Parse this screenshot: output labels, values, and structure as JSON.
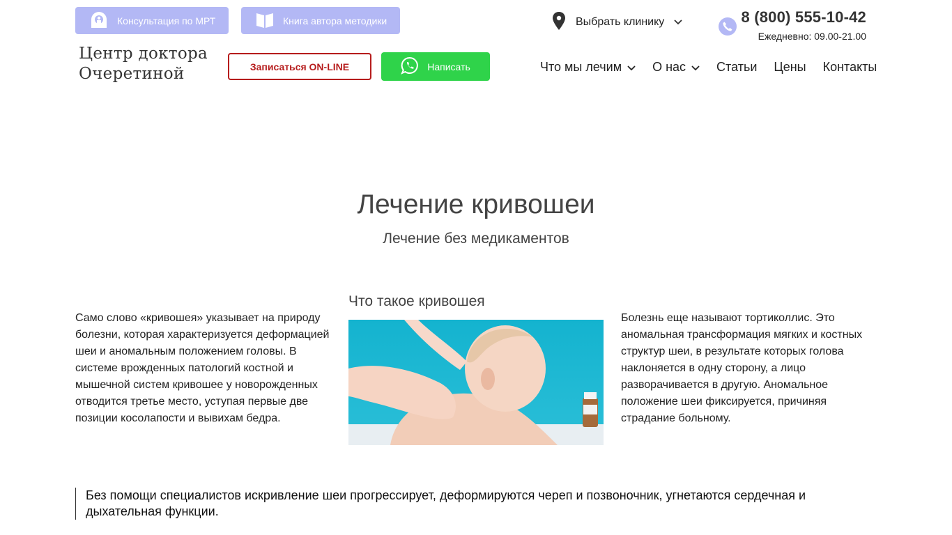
{
  "top_bar": {
    "mri_label": "Консультация по МРТ",
    "book_label": "Книга автора методики",
    "clinic_label": "Выбрать клинику",
    "phone": "8 (800) 555-10-42",
    "hours": "Ежедневно: 09.00-21.00"
  },
  "header": {
    "logo_line1": "Центр доктора",
    "logo_line2": "Очеретиной",
    "online_label": "Записаться ON-LINE",
    "whatsapp_label": "Написать"
  },
  "nav": {
    "items": [
      {
        "label": "Что мы лечим",
        "has_dropdown": true
      },
      {
        "label": "О нас",
        "has_dropdown": true
      },
      {
        "label": "Статьи",
        "has_dropdown": false
      },
      {
        "label": "Цены",
        "has_dropdown": false
      },
      {
        "label": "Контакты",
        "has_dropdown": false
      }
    ]
  },
  "hero": {
    "title": "Лечение кривошеи",
    "subtitle": "Лечение без медикаментов"
  },
  "content": {
    "left_text": "Само слово «кривошея» указывает на природу болезни, которая характеризуется деформацией шеи и аномальным положением головы. В системе врожденных патологий костной и мышечной систем кривошее у новорожденных отводится третье место, уступая первые две позиции косолапости и вывихам бедра.",
    "middle_title": "Что такое кривошея",
    "right_text": "Болезнь еще называют тортиколлис. Это аномальная трансформация мягких и костных структур шеи, в результате которых голова наклоняется в одну сторону, а лицо разворачивается в другую. Аномальное положение шеи фиксируется, причиняя страдание больному.",
    "quote": "Без помощи специалистов искривление шеи прогрессирует, деформируются череп и позвоночник, угнетаются сердечная и дыхательная функции."
  },
  "colors": {
    "top_button_bg": "#b3b8f5",
    "online_border": "#b61c1c",
    "whatsapp_bg": "#2fd34a",
    "photo_bg": "#1bb7d1"
  },
  "icons": {
    "mri": "mri-scanner-icon",
    "book": "open-book-icon",
    "clinic": "map-pin-icon",
    "phone": "phone-icon",
    "whatsapp": "whatsapp-icon",
    "dropdown": "chevron-down-icon"
  }
}
